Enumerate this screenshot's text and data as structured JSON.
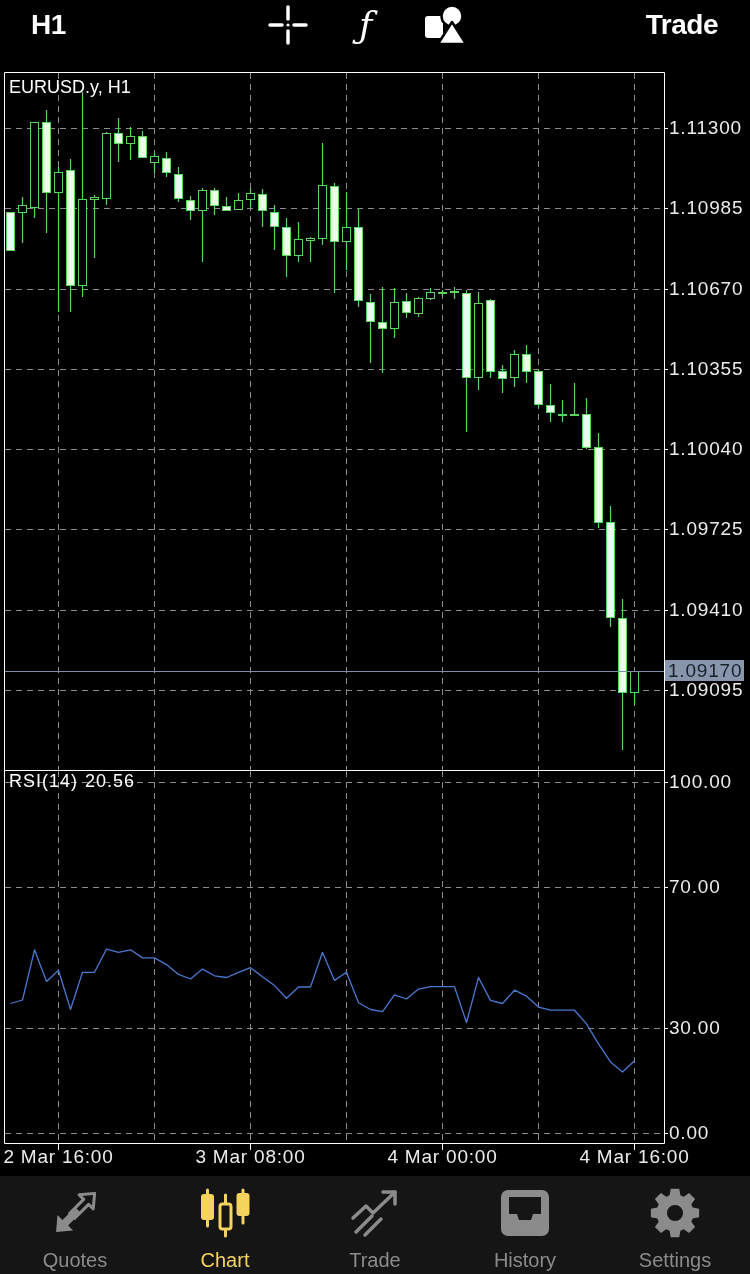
{
  "top_bar": {
    "timeframe": "H1",
    "indicator_glyph": "ƒ",
    "trade_button": "Trade"
  },
  "price_chart": {
    "chart_data": {
      "type": "candlestick",
      "title": "EURUSD.y, H1",
      "categories": [
        null,
        null,
        null,
        null,
        null,
        null,
        null,
        null,
        null,
        null,
        null,
        null,
        null,
        null,
        null,
        null,
        null,
        null,
        null,
        null,
        null,
        null,
        null,
        null,
        null,
        null,
        null,
        null,
        null,
        null,
        null,
        null,
        null,
        null,
        null,
        null,
        null,
        null,
        null,
        null,
        null,
        null,
        null,
        null,
        null,
        null,
        null,
        null,
        null,
        null,
        null,
        null,
        null,
        null,
        null
      ],
      "ohlc": [
        [
          1.1097,
          1.1097,
          1.10821,
          1.10821
        ],
        [
          1.1097,
          1.11029,
          1.10849,
          1.10998
        ],
        [
          1.1099,
          1.11324,
          1.10947,
          1.11324
        ],
        [
          1.11324,
          1.11371,
          1.10888,
          1.11049
        ],
        [
          1.11049,
          1.11147,
          1.10578,
          1.11127
        ],
        [
          1.11135,
          1.11178,
          1.10578,
          1.10684
        ],
        [
          1.10684,
          1.11441,
          1.10637,
          1.11021
        ],
        [
          1.11021,
          1.11037,
          1.1079,
          1.11029
        ],
        [
          1.11025,
          1.11284,
          1.10998,
          1.1128
        ],
        [
          1.1128,
          1.11339,
          1.11167,
          1.11241
        ],
        [
          1.11241,
          1.11304,
          1.11174,
          1.11269
        ],
        [
          1.11269,
          1.11288,
          1.11186,
          1.11186
        ],
        [
          1.11167,
          1.11202,
          1.11123,
          1.1119
        ],
        [
          1.11182,
          1.11206,
          1.11108,
          1.11127
        ],
        [
          1.1112,
          1.11147,
          1.1101,
          1.11025
        ],
        [
          1.11018,
          1.11033,
          1.10939,
          1.10978
        ],
        [
          1.10978,
          1.11065,
          1.10774,
          1.11057
        ],
        [
          1.11057,
          1.11065,
          1.10959,
          1.10998
        ],
        [
          1.10994,
          1.11029,
          1.10978,
          1.10978
        ],
        [
          1.10982,
          1.11045,
          1.10978,
          1.11018
        ],
        [
          1.11021,
          1.11065,
          1.1099,
          1.11045
        ],
        [
          1.11041,
          1.11061,
          1.10912,
          1.10978
        ],
        [
          1.1097,
          1.10998,
          1.10821,
          1.10915
        ],
        [
          1.10912,
          1.10947,
          1.10715,
          1.10802
        ],
        [
          1.10802,
          1.10931,
          1.10774,
          1.10864
        ],
        [
          1.10861,
          1.10872,
          1.10774,
          1.10868
        ],
        [
          1.10868,
          1.11241,
          1.10841,
          1.11076
        ],
        [
          1.11072,
          1.11084,
          1.10653,
          1.10857
        ],
        [
          1.10857,
          1.11049,
          1.10743,
          1.10912
        ],
        [
          1.10912,
          1.10982,
          1.10598,
          1.10625
        ],
        [
          1.10617,
          1.10649,
          1.10378,
          1.10543
        ],
        [
          1.10539,
          1.10676,
          1.10339,
          1.10515
        ],
        [
          1.10515,
          1.10672,
          1.10476,
          1.10617
        ],
        [
          1.10621,
          1.10653,
          1.10555,
          1.10578
        ],
        [
          1.10574,
          1.10637,
          1.10558,
          1.10633
        ],
        [
          1.10633,
          1.10672,
          1.10625,
          1.10657
        ],
        [
          1.10657,
          1.10664,
          1.10641,
          1.10653
        ],
        [
          1.1066,
          1.10676,
          1.10629,
          1.10657
        ],
        [
          1.10653,
          1.10664,
          1.10107,
          1.10323
        ],
        [
          1.10323,
          1.10657,
          1.10272,
          1.10613
        ],
        [
          1.10625,
          1.10629,
          1.10319,
          1.10347
        ],
        [
          1.10347,
          1.1037,
          1.1026,
          1.10319
        ],
        [
          1.10323,
          1.10429,
          1.10284,
          1.10413
        ],
        [
          1.10413,
          1.10449,
          1.103,
          1.10347
        ],
        [
          1.10347,
          1.10354,
          1.10205,
          1.10217
        ],
        [
          1.10213,
          1.10296,
          1.10147,
          1.10186
        ],
        [
          1.10178,
          1.10233,
          1.10147,
          1.10174
        ],
        [
          1.10178,
          1.103,
          1.10174,
          1.10174
        ],
        [
          1.10178,
          1.10241,
          1.10041,
          1.10048
        ],
        [
          1.10048,
          1.10103,
          1.09731,
          1.09754
        ],
        [
          1.09754,
          1.09817,
          1.09342,
          1.09381
        ],
        [
          1.09377,
          1.09452,
          1.0886,
          1.09087
        ],
        [
          1.09087,
          1.0917,
          1.09036,
          1.0917
        ],
        null,
        null
      ],
      "ylim": [
        1.08781,
        1.1152
      ],
      "yticks": [
        {
          "value": 1.113,
          "label": "1.11300"
        },
        {
          "value": 1.10985,
          "label": "1.10985"
        },
        {
          "value": 1.1067,
          "label": "1.10670"
        },
        {
          "value": 1.10355,
          "label": "1.10355"
        },
        {
          "value": 1.1004,
          "label": "1.10040"
        },
        {
          "value": 1.09725,
          "label": "1.09725"
        },
        {
          "value": 1.0941,
          "label": "1.09410"
        },
        {
          "value": 1.09095,
          "label": "1.09095"
        }
      ],
      "grid": true,
      "ref_lines": [
        {
          "axis": "y",
          "value": 1.0917,
          "label": "1.09170"
        }
      ]
    }
  },
  "rsi_panel": {
    "reading": "20.56",
    "chart_data": {
      "type": "line",
      "categories": [
        null,
        null,
        null,
        null,
        "2 Mar 16:00",
        null,
        null,
        null,
        null,
        null,
        null,
        null,
        null,
        null,
        null,
        null,
        null,
        null,
        null,
        null,
        "3 Mar 08:00",
        null,
        null,
        null,
        null,
        null,
        null,
        null,
        null,
        null,
        null,
        null,
        null,
        null,
        null,
        null,
        "4 Mar 00:00",
        null,
        null,
        null,
        null,
        null,
        null,
        null,
        null,
        null,
        null,
        null,
        null,
        null,
        null,
        null,
        "4 Mar 16:00",
        null,
        null
      ],
      "ylim": [
        -2.8,
        103.1
      ],
      "yticks": [
        {
          "value": 100,
          "label": "100.00"
        },
        {
          "value": 70,
          "label": "70.00"
        },
        {
          "value": 30,
          "label": "30.00"
        },
        {
          "value": 0,
          "label": "0.00"
        }
      ],
      "grid": true,
      "series": [
        {
          "name": "RSI(14)",
          "color": "#4a78d0",
          "values": [
            36.9,
            37.9,
            52.2,
            43.2,
            46.4,
            35.2,
            45.8,
            45.8,
            52.4,
            51.5,
            52.2,
            49.9,
            49.9,
            48,
            45.2,
            43.9,
            46.7,
            44.8,
            44.3,
            45.8,
            47.1,
            44.5,
            42,
            38.4,
            41.6,
            41.6,
            51.5,
            43.5,
            45.8,
            37.1,
            35.2,
            34.6,
            39.4,
            38.2,
            41,
            41.7,
            41.7,
            41.7,
            31.5,
            44.3,
            37.8,
            36.9,
            40.7,
            39,
            35.9,
            35,
            35,
            35,
            31.1,
            25.4,
            20.3,
            17.4,
            20.6,
            null,
            null
          ]
        }
      ]
    }
  },
  "tab_bar": [
    {
      "label": "Quotes",
      "kind": "arrows",
      "selected": false
    },
    {
      "label": "Chart",
      "kind": "candles",
      "selected": true
    },
    {
      "label": "Trade",
      "kind": "trend",
      "selected": false
    },
    {
      "label": "History",
      "kind": "tray",
      "selected": false
    },
    {
      "label": "Settings",
      "kind": "gear",
      "selected": false
    }
  ]
}
